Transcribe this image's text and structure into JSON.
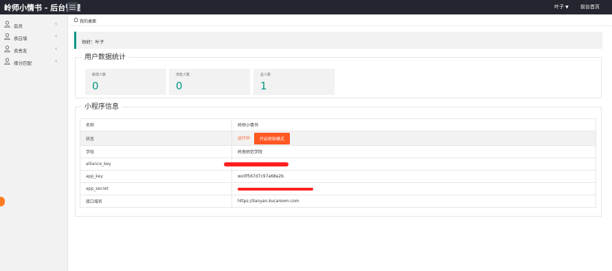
{
  "app": {
    "title": "岭师小情书 - 后台管理"
  },
  "header": {
    "user": "叶子",
    "home_link": "前台首页"
  },
  "sidebar": {
    "items": [
      {
        "label": "会员"
      },
      {
        "label": "表白墙"
      },
      {
        "label": "卖舍友"
      },
      {
        "label": "缘分匹配"
      }
    ]
  },
  "breadcrumb": {
    "label": "我的桌面"
  },
  "greeting": {
    "text": "你好：叶子"
  },
  "stats": {
    "title": "用户数据统计",
    "cards": [
      {
        "label": "新增人数",
        "value": "0"
      },
      {
        "label": "浏览人数",
        "value": "0"
      },
      {
        "label": "总人数",
        "value": "1"
      }
    ]
  },
  "miniprogram": {
    "title": "小程序信息",
    "rows": [
      {
        "key": "名称",
        "value": "岭师小情书"
      },
      {
        "key": "状态",
        "value": "运行中",
        "button": "开启审核模式"
      },
      {
        "key": "学校",
        "value": "岭南师范学院"
      },
      {
        "key": "alliance_key",
        "value": ""
      },
      {
        "key": "app_key",
        "value": "wx0f567d7c97a68e2b"
      },
      {
        "key": "app_secret",
        "value": ""
      },
      {
        "key": "接口域名",
        "value": "https://lianyan.kucaroom.com"
      }
    ]
  },
  "colors": {
    "accent": "#009688",
    "danger": "#ff5722",
    "topbar": "#23262e"
  }
}
